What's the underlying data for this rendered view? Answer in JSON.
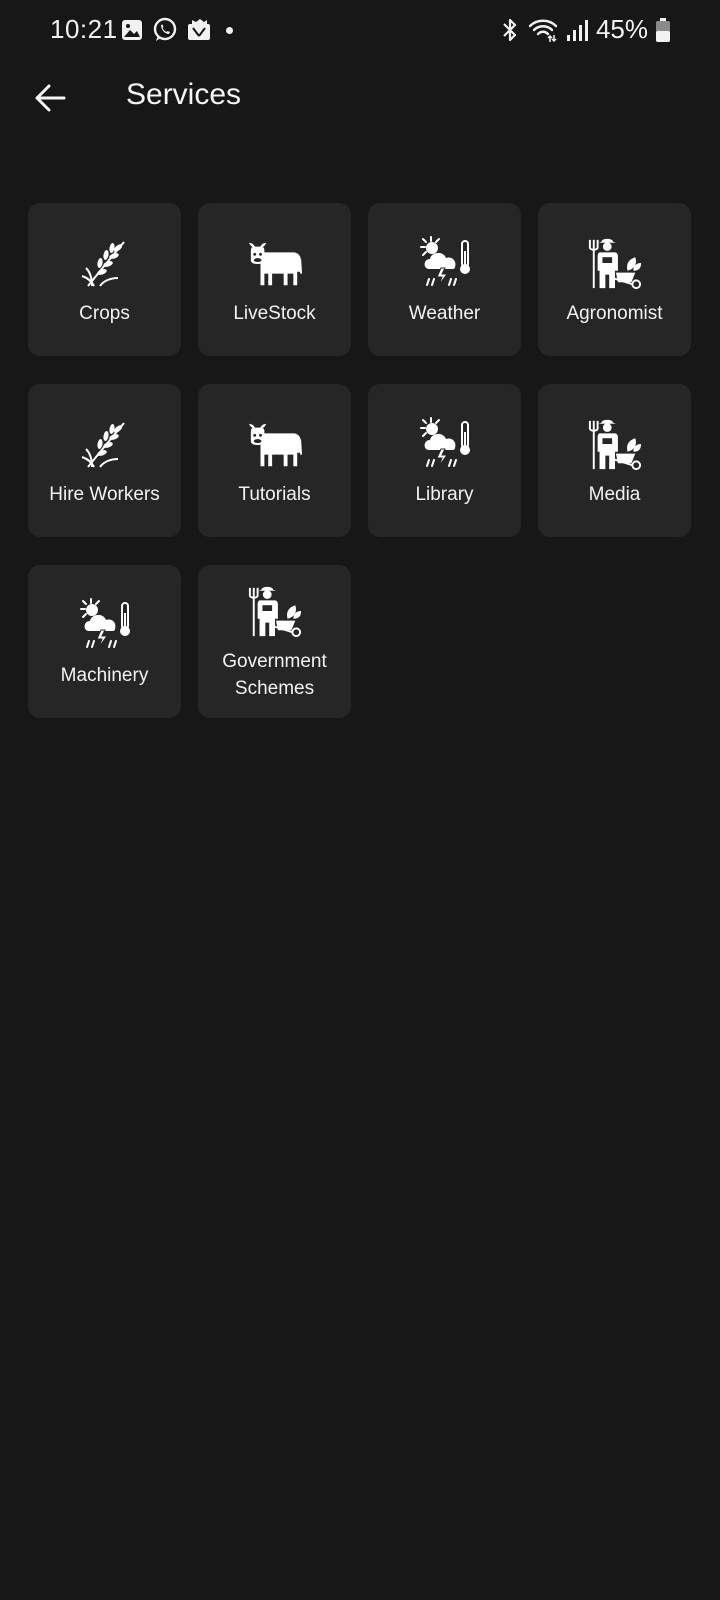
{
  "status_bar": {
    "time": "10:21",
    "battery": "45%",
    "left_icons": [
      "gallery-icon",
      "whatsapp-icon",
      "app-notification-icon"
    ],
    "right_icons": [
      "bluetooth-icon",
      "wifi-icon",
      "signal-icon",
      "battery-icon"
    ]
  },
  "app_bar": {
    "title": "Services",
    "back_icon": "arrow-left-icon"
  },
  "services": [
    {
      "label": "Crops",
      "icon": "wheat-icon"
    },
    {
      "label": "LiveStock",
      "icon": "cow-icon"
    },
    {
      "label": "Weather",
      "icon": "weather-icon"
    },
    {
      "label": "Agronomist",
      "icon": "farmer-icon"
    },
    {
      "label": "Hire Workers",
      "icon": "wheat-icon"
    },
    {
      "label": "Tutorials",
      "icon": "cow-icon"
    },
    {
      "label": "Library",
      "icon": "weather-icon"
    },
    {
      "label": "Media",
      "icon": "farmer-icon"
    },
    {
      "label": "Machinery",
      "icon": "weather-icon"
    },
    {
      "label": "Government Schemes",
      "icon": "farmer-icon"
    }
  ],
  "colors": {
    "background": "#171717",
    "tile": "#262626",
    "text": "#f2f2f2"
  }
}
